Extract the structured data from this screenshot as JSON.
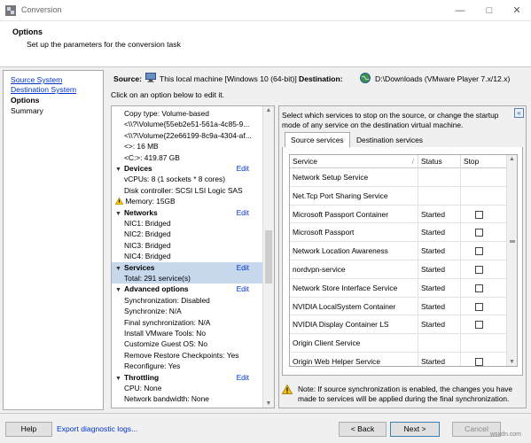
{
  "window": {
    "title": "Conversion",
    "icons": [
      "app-icon",
      "minimize-icon",
      "maximize-icon",
      "close-icon"
    ]
  },
  "header": {
    "title": "Options",
    "subtitle": "Set up the parameters for the conversion task"
  },
  "steps": [
    {
      "label": "Source System",
      "state": "link"
    },
    {
      "label": "Destination System",
      "state": "link"
    },
    {
      "label": "Options",
      "state": "current"
    },
    {
      "label": "Summary",
      "state": "plain"
    }
  ],
  "source": {
    "label": "Source:",
    "value": "This local machine [Windows 10 (64-bit)]",
    "icon": "computer-icon"
  },
  "destination": {
    "label": "Destination:",
    "value": "D:\\Downloads (VMware Player 7.x/12.x)",
    "icon": "globe-icon"
  },
  "instruction": "Click on an option below to edit it.",
  "tree": {
    "edit_label": "Edit",
    "pre_items": [
      "Copy type: Volume-based",
      "<\\\\?\\Volume{55eb2e51-561a-4c85-9...",
      "<\\\\?\\Volume{22e66199-8c9a-4304-af...",
      "<>: 16 MB",
      "<C:>: 419.87 GB"
    ],
    "sections": [
      {
        "title": "Devices",
        "items": [
          "vCPUs: 8 (1 sockets * 8 cores)",
          "Disk controller: SCSI LSI Logic SAS",
          "Memory: 15GB"
        ]
      },
      {
        "title": "Networks",
        "items": [
          "NIC1: Bridged",
          "NIC2: Bridged",
          "NIC3: Bridged",
          "NIC4: Bridged"
        ]
      },
      {
        "title": "Services",
        "items": [
          "Total: 291 service(s)"
        ],
        "selected": true
      },
      {
        "title": "Advanced options",
        "items": [
          "Synchronization: Disabled",
          "Synchronize: N/A",
          "Final synchronization: N/A",
          "Install VMware Tools: No",
          "Customize Guest OS: No",
          "Remove Restore Checkpoints: Yes",
          "Reconfigure: Yes"
        ]
      },
      {
        "title": "Throttling",
        "items": [
          "CPU: None",
          "Network bandwidth: None"
        ]
      }
    ]
  },
  "panel": {
    "description": "Select which services to stop on the source, or change the startup mode of any service on the destination virtual machine.",
    "tabs": [
      "Source services",
      "Destination services"
    ],
    "active_tab": "Source services",
    "columns": [
      "Service",
      "Status",
      "Stop"
    ],
    "rows": [
      {
        "service": "Network Setup Service",
        "status": "",
        "stop": null
      },
      {
        "service": "Net.Tcp Port Sharing Service",
        "status": "",
        "stop": null
      },
      {
        "service": "Microsoft Passport Container",
        "status": "Started",
        "stop": false
      },
      {
        "service": "Microsoft Passport",
        "status": "Started",
        "stop": false
      },
      {
        "service": "Network Location Awareness",
        "status": "Started",
        "stop": false
      },
      {
        "service": "nordvpn-service",
        "status": "Started",
        "stop": false
      },
      {
        "service": "Network Store Interface Service",
        "status": "Started",
        "stop": false
      },
      {
        "service": "NVIDIA LocalSystem Container",
        "status": "Started",
        "stop": false
      },
      {
        "service": "NVIDIA Display Container LS",
        "status": "Started",
        "stop": false
      },
      {
        "service": "Origin Client Service",
        "status": "",
        "stop": null
      },
      {
        "service": "Origin Web Helper Service",
        "status": "Started",
        "stop": false
      }
    ],
    "note": "Note: If source synchronization is enabled, the changes you have made to services will be applied during the final synchronization."
  },
  "footer": {
    "help": "Help",
    "diagnostic": "Export diagnostic logs...",
    "back": "< Back",
    "next": "Next >",
    "cancel": "Cancel"
  },
  "watermark": "wsxdn.com",
  "colors": {
    "link": "#0033cc",
    "selection": "#c8d8ec",
    "edit": "#0033cc"
  }
}
